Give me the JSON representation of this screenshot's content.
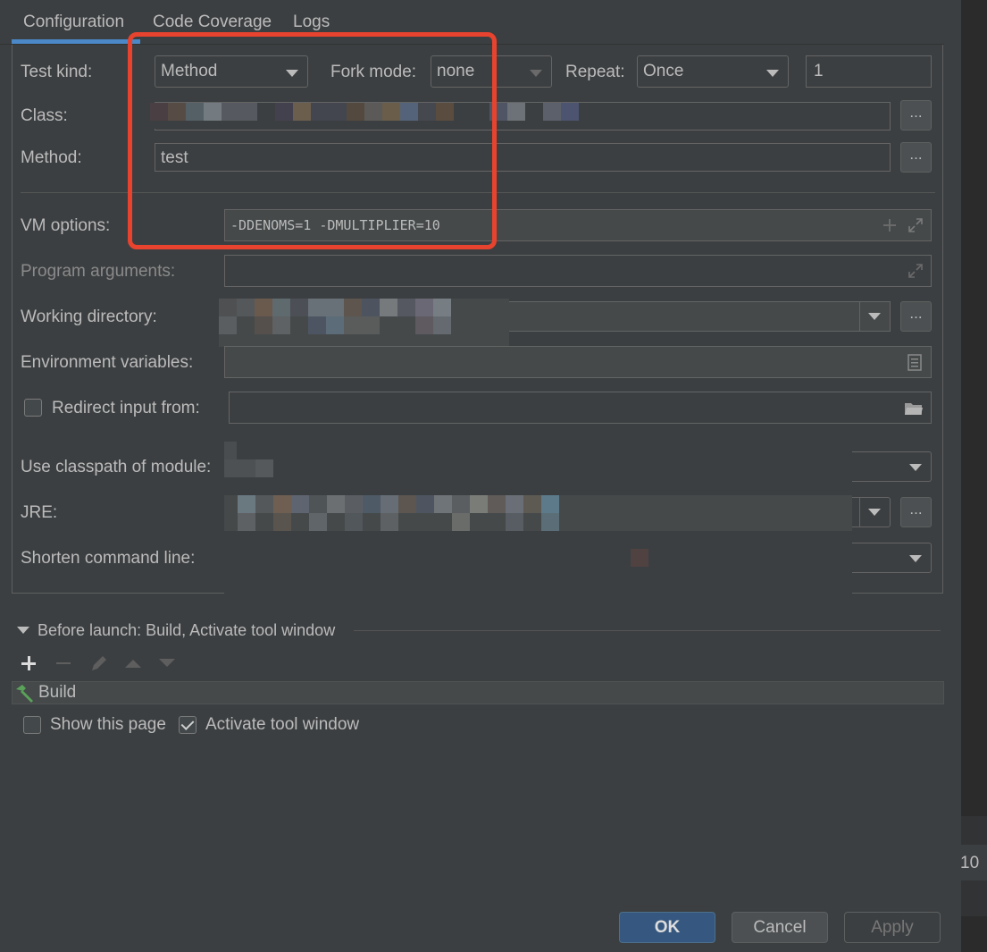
{
  "tabs": [
    {
      "label": "Configuration"
    },
    {
      "label": "Code Coverage"
    },
    {
      "label": "Logs"
    }
  ],
  "form": {
    "test_kind_label": "Test kind:",
    "test_kind_value": "Method",
    "fork_mode_label": "Fork mode:",
    "fork_mode_value": "none",
    "repeat_label": "Repeat:",
    "repeat_value": "Once",
    "repeat_count": "1",
    "class_label": "Class:",
    "method_label": "Method:",
    "method_value": "test",
    "vm_options_label": "VM options:",
    "vm_options_value": "-DDENOMS=1 -DMULTIPLIER=10",
    "program_arguments_label": "Program arguments:",
    "working_directory_label": "Working directory:",
    "environment_variables_label": "Environment variables:",
    "redirect_input_label": "Redirect input from:",
    "classpath_module_label": "Use classpath of module:",
    "jre_label": "JRE:",
    "shorten_cmd_label": "Shorten command line:",
    "browse_label": "..."
  },
  "before_launch": {
    "title": "Before launch: Build, Activate tool window",
    "tasks": [
      {
        "label": "Build"
      }
    ],
    "show_page_label": "Show this page",
    "show_page_checked": false,
    "activate_tool_window_label": "Activate tool window",
    "activate_tool_window_checked": true
  },
  "buttons": {
    "ok": "OK",
    "cancel": "Cancel",
    "apply": "Apply"
  },
  "background": {
    "partial_text": "10"
  },
  "colors": {
    "bg": "#3c3f41",
    "field_bg": "#45494a",
    "accent": "#4a88c7",
    "ok_button": "#365880",
    "highlight": "#e8432e"
  }
}
